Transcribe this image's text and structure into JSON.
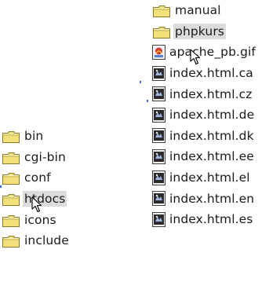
{
  "left_column": {
    "items": [
      {
        "label": "bin",
        "icon": "folder-icon"
      },
      {
        "label": "cgi-bin",
        "icon": "folder-icon"
      },
      {
        "label": "conf",
        "icon": "folder-icon"
      },
      {
        "label": "htdocs",
        "icon": "folder-icon",
        "selected": true
      },
      {
        "label": "icons",
        "icon": "folder-icon"
      },
      {
        "label": "include",
        "icon": "folder-icon"
      }
    ]
  },
  "right_column": {
    "items": [
      {
        "label": "manual",
        "icon": "folder-icon"
      },
      {
        "label": "phpkurs",
        "icon": "folder-icon",
        "selected": true
      },
      {
        "label": "apache_pb.gif",
        "icon": "gif-image-icon"
      },
      {
        "label": "index.html.ca",
        "icon": "html-file-icon"
      },
      {
        "label": "index.html.cz",
        "icon": "html-file-icon"
      },
      {
        "label": "index.html.de",
        "icon": "html-file-icon"
      },
      {
        "label": "index.html.dk",
        "icon": "html-file-icon"
      },
      {
        "label": "index.html.ee",
        "icon": "html-file-icon"
      },
      {
        "label": "index.html.el",
        "icon": "html-file-icon"
      },
      {
        "label": "index.html.en",
        "icon": "html-file-icon"
      },
      {
        "label": "index.html.es",
        "icon": "html-file-icon"
      }
    ]
  },
  "colors": {
    "folder_fill": "#f4e07a",
    "folder_stroke": "#8a7a2a",
    "selection": "#dcdcdc",
    "text": "#1a1a1a"
  }
}
